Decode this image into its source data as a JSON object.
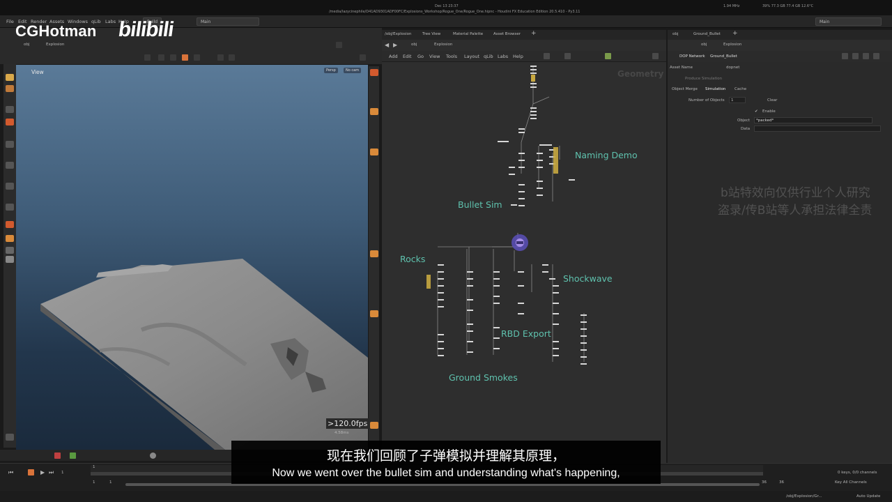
{
  "system_bar": {
    "datetime": "Dec 13  23:37",
    "window_title": "/media/lazycinephile/D41AD9301ADF00FC/Explosions_Workshop/Rogue_One/Rogue_One.hipnc - Houdini FX Education Edition 20.5.410 - Py3.11",
    "stats": "39%  77.3 GB  77.4 GB  12.6°C",
    "cpu": "1.94 MHz"
  },
  "menubar": {
    "items": [
      "File",
      "Edit",
      "Render",
      "Assets",
      "Windows",
      "qLib",
      "Labs",
      "Help"
    ],
    "build_label": "Build",
    "desktop_left": "Main",
    "desktop_right": "Main"
  },
  "watermark": {
    "logo": "CGHotman",
    "bili": "bilibili",
    "notice_line1": "b站特效向仅供行业个人研究",
    "notice_line2": "盗录/传B站等人承担法律全责"
  },
  "viewport": {
    "path_root": "obj",
    "path_node": "Explosion",
    "title": "View",
    "camera_persp": "Persp",
    "camera_nocam": "No cam",
    "fps": ">120.0fps",
    "sub_stat": "4.58ms"
  },
  "network_panel": {
    "tabs": [
      "/obj/Explosion",
      "Tree View",
      "Material Palette",
      "Asset Browser"
    ],
    "path_root": "obj",
    "path_node": "Explosion",
    "menu": [
      "Add",
      "Edit",
      "Go",
      "View",
      "Tools",
      "Layout",
      "qLib",
      "Labs",
      "Help"
    ],
    "context_watermark": "Geometry",
    "labels": {
      "naming_demo": "Naming Demo",
      "bullet_sim": "Bullet Sim",
      "rocks": "Rocks",
      "shockwave": "Shockwave",
      "rbd_export": "RBD Export",
      "ground_smokes": "Ground Smokes"
    }
  },
  "param_panel": {
    "tabs": [
      "obj",
      "Ground_Bullet"
    ],
    "path_root": "obj",
    "path_node": "Explosion",
    "node_type": "DOP Network",
    "node_name": "Ground_Bullet",
    "asset_name_label": "Asset Name",
    "asset_name_value": "dopnet",
    "section": "Produce Simulation",
    "subtabs": [
      "Object Merge",
      "Simulation",
      "Cache"
    ],
    "num_objects_label": "Number of Objects",
    "num_objects_value": "1",
    "clear_label": "Clear",
    "enable_label": "Enable",
    "object_label": "Object",
    "object_value": "*packed*",
    "data_label": "Data"
  },
  "timeline": {
    "frame_start": "1",
    "frame_current": "1",
    "frame_end": "36",
    "frame_end2": "36",
    "range_start": "1",
    "range_start2": "1",
    "keys_info": "0 keys, 0/0 channels",
    "key_all": "Key All Channels",
    "auto_update": "Auto Update",
    "status_path": "/obj/Explosion/Gr..."
  },
  "subtitles": {
    "chinese": "现在我们回顾了子弹模拟并理解其原理，",
    "english": "Now we went over the bullet sim and understanding what's happening,"
  },
  "colors": {
    "network_bg": "#2e2e2e",
    "label": "#5fc2ae",
    "viewport_top": "#5a7a98",
    "viewport_bottom": "#1a2a3c",
    "accent_orange": "#e07a30"
  }
}
